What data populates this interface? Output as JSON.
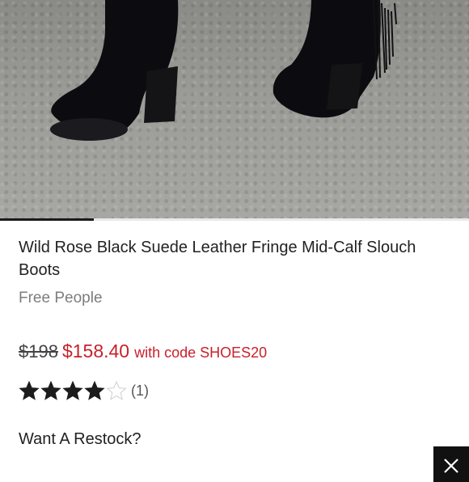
{
  "product": {
    "title": "Wild Rose Black Suede Leather Fringe Mid-Calf Slouch Boots",
    "brand": "Free People",
    "image_description_icon": "product-photo"
  },
  "gallery": {
    "progress_fraction": 0.2
  },
  "pricing": {
    "original_price": "$198",
    "sale_price": "$158.40",
    "promo_text": "with code SHOES20",
    "sale_color": "#c8202a"
  },
  "rating": {
    "stars": 4,
    "max_stars": 5,
    "count_label": "(1)"
  },
  "restock": {
    "label": "Want A Restock?"
  },
  "close_button": {
    "icon": "close-icon"
  }
}
